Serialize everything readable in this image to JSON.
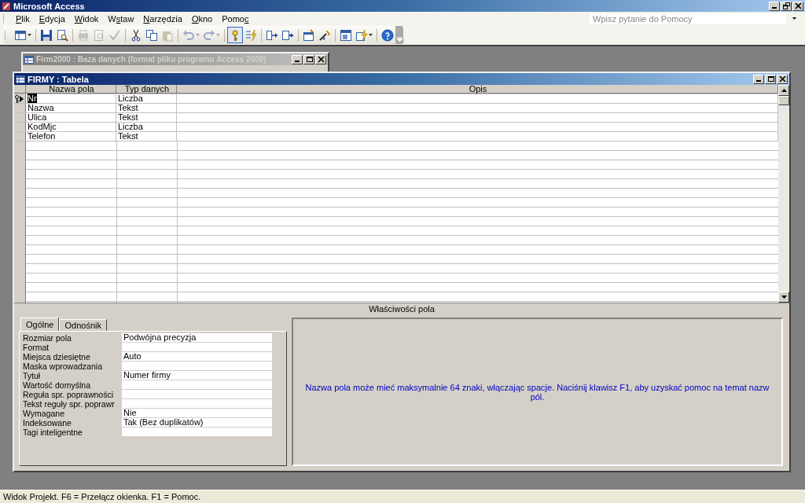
{
  "app_window": {
    "title": "Microsoft Access"
  },
  "menu": [
    {
      "label": "Plik"
    },
    {
      "label": "Edycja"
    },
    {
      "label": "Widok"
    },
    {
      "label": "Wstaw"
    },
    {
      "label": "Narzędzia"
    },
    {
      "label": "Okno"
    },
    {
      "label": "Pomoc"
    }
  ],
  "help_box": {
    "placeholder": "Wpisz pytanie do Pomocy"
  },
  "toolbar": [
    {
      "kind": "view",
      "disabled": false,
      "pressed": false
    },
    {
      "kind": "sep"
    },
    {
      "kind": "save",
      "disabled": false,
      "pressed": false
    },
    {
      "kind": "find",
      "disabled": false,
      "pressed": false
    },
    {
      "kind": "sep"
    },
    {
      "kind": "print",
      "disabled": true,
      "pressed": false
    },
    {
      "kind": "preview",
      "disabled": true,
      "pressed": false
    },
    {
      "kind": "spell",
      "disabled": true,
      "pressed": false
    },
    {
      "kind": "sep"
    },
    {
      "kind": "cut",
      "disabled": false,
      "pressed": false
    },
    {
      "kind": "copy",
      "disabled": false,
      "pressed": false
    },
    {
      "kind": "paste",
      "disabled": true,
      "pressed": false
    },
    {
      "kind": "sep"
    },
    {
      "kind": "undo",
      "disabled": true,
      "pressed": false
    },
    {
      "kind": "redo",
      "disabled": true,
      "pressed": false
    },
    {
      "kind": "sep"
    },
    {
      "kind": "key",
      "disabled": false,
      "pressed": true
    },
    {
      "kind": "index",
      "disabled": false,
      "pressed": false
    },
    {
      "kind": "sep"
    },
    {
      "kind": "insert_rows",
      "disabled": false,
      "pressed": false
    },
    {
      "kind": "delete_rows",
      "disabled": false,
      "pressed": false
    },
    {
      "kind": "sep"
    },
    {
      "kind": "properties",
      "disabled": false,
      "pressed": false
    },
    {
      "kind": "build",
      "disabled": false,
      "pressed": false
    },
    {
      "kind": "sep"
    },
    {
      "kind": "db_window",
      "disabled": false,
      "pressed": false
    },
    {
      "kind": "new_object",
      "disabled": false,
      "pressed": false
    },
    {
      "kind": "sep"
    },
    {
      "kind": "help",
      "disabled": false,
      "pressed": false
    }
  ],
  "database_window": {
    "title": "Firm2000 : Baza danych (format pliku programu Access 2000)",
    "active": false
  },
  "table_window": {
    "title": "FIRMY : Tabela",
    "active": true
  },
  "table": {
    "columns": [
      "Nazwa pola",
      "Typ danych",
      "Opis"
    ],
    "rows": [
      {
        "field": "Nr",
        "type": "Liczba",
        "primary_key": true,
        "selected": true
      },
      {
        "field": "Nazwa",
        "type": "Tekst",
        "primary_key": false,
        "selected": false
      },
      {
        "field": "Ulica",
        "type": "Tekst",
        "primary_key": false,
        "selected": false
      },
      {
        "field": "KodMjc",
        "type": "Liczba",
        "primary_key": false,
        "selected": false
      },
      {
        "field": "Telefon",
        "type": "Tekst",
        "primary_key": false,
        "selected": false
      }
    ]
  },
  "field_properties": {
    "title": "Właściwości pola",
    "tabs": [
      {
        "label": "Ogólne",
        "selected": true
      },
      {
        "label": "Odnośnik",
        "selected": false
      }
    ],
    "properties": [
      {
        "label": "Rozmiar pola",
        "value": "Podwójna precyzja"
      },
      {
        "label": "Format"
      },
      {
        "label": "Miejsca dziesiętne",
        "value": "Auto"
      },
      {
        "label": "Maska wprowadzania"
      },
      {
        "label": "Tytuł",
        "value": "Numer firmy"
      },
      {
        "label": "Wartość domyślna"
      },
      {
        "label": "Reguła spr. poprawności"
      },
      {
        "label": "Tekst reguły spr. poprawr"
      },
      {
        "label": "Wymagane",
        "value": "Nie"
      },
      {
        "label": "Indeksowane",
        "value": "Tak (Bez duplikatów)"
      },
      {
        "label": "Tagi inteligentne"
      }
    ],
    "help_text": "Nazwa pola może mieć maksymalnie 64 znaki, włączając spacje. Naciśnij klawisz F1, aby uzyskać pomoc na temat nazw pól."
  },
  "status_bar": {
    "text": "Widok Projekt. F6 = Przełącz okienka. F1 = Pomoc."
  }
}
